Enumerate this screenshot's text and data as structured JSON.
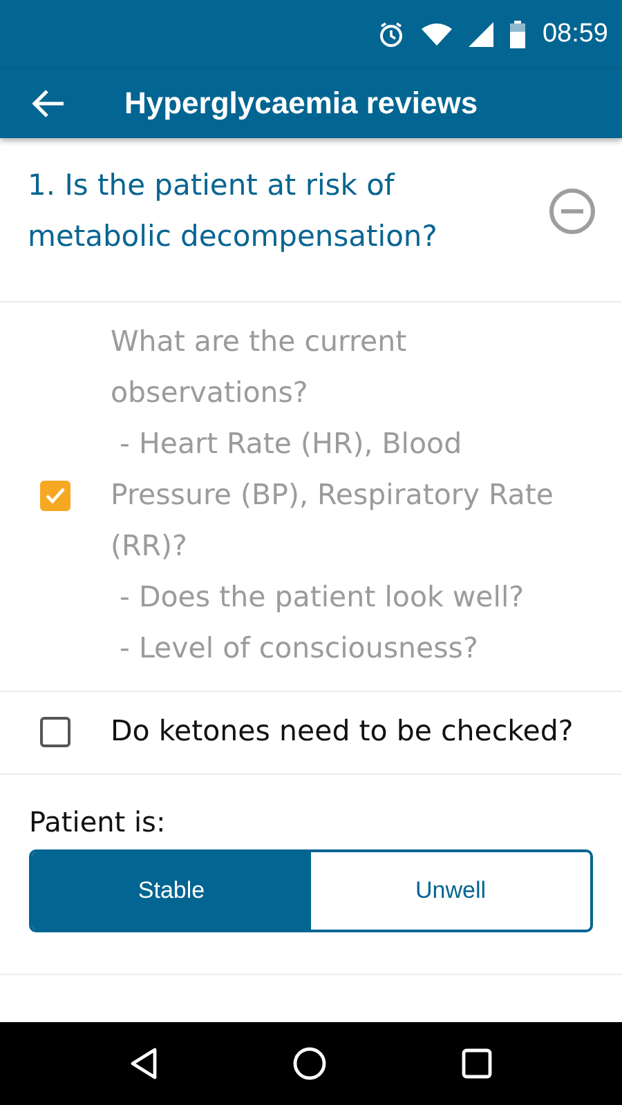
{
  "status_bar": {
    "time": "08:59"
  },
  "app_bar": {
    "title": "Hyperglycaemia reviews"
  },
  "question": {
    "title": "1. Is the patient at risk of metabolic decompensation?",
    "expanded": true
  },
  "checklist": [
    {
      "text": "What are the current observations?\n - Heart Rate (HR), Blood Pressure (BP), Respiratory Rate (RR)?\n - Does the patient look well?\n - Level of consciousness?",
      "checked": true
    },
    {
      "text": "Do ketones need to be checked?",
      "checked": false
    }
  ],
  "patient_status": {
    "label": "Patient is:",
    "options": [
      {
        "label": "Stable",
        "selected": true
      },
      {
        "label": "Unwell",
        "selected": false
      }
    ]
  }
}
